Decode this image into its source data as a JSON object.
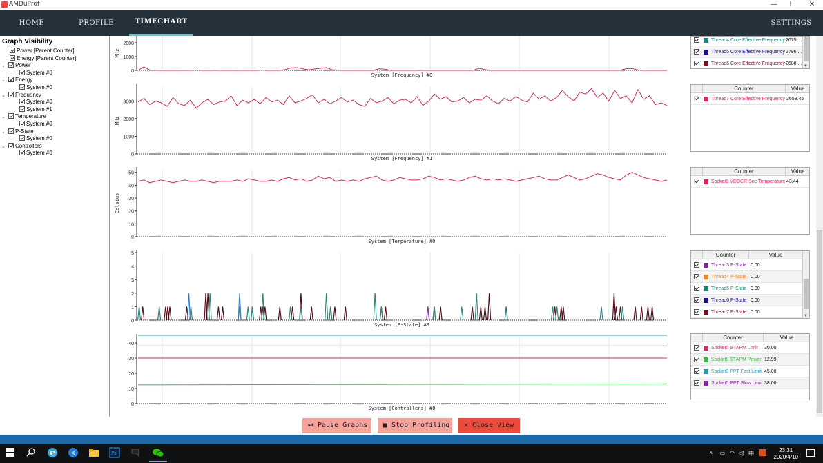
{
  "window": {
    "title": "AMDuProf",
    "min": "—",
    "restore": "❐",
    "close": "✕"
  },
  "nav": {
    "home": "HOME",
    "profile": "PROFILE",
    "timechart": "TIMECHART",
    "settings": "SETTINGS"
  },
  "tree": {
    "title": "Graph Visibility",
    "nodes": [
      {
        "label": "Power [Parent Counter]",
        "depth": 1,
        "arrow": false
      },
      {
        "label": "Energy [Parent Counter]",
        "depth": 1,
        "arrow": false
      },
      {
        "label": "Power",
        "depth": 1,
        "arrow": true
      },
      {
        "label": "System #0",
        "depth": 2,
        "arrow": false
      },
      {
        "label": "Energy",
        "depth": 1,
        "arrow": true
      },
      {
        "label": "System #0",
        "depth": 2,
        "arrow": false
      },
      {
        "label": "Frequency",
        "depth": 1,
        "arrow": true
      },
      {
        "label": "System #0",
        "depth": 2,
        "arrow": false
      },
      {
        "label": "System #1",
        "depth": 2,
        "arrow": false
      },
      {
        "label": "Temperature",
        "depth": 1,
        "arrow": true
      },
      {
        "label": "System #0",
        "depth": 2,
        "arrow": false
      },
      {
        "label": "P-State",
        "depth": 1,
        "arrow": true
      },
      {
        "label": "System #0",
        "depth": 2,
        "arrow": false
      },
      {
        "label": "Controllers",
        "depth": 1,
        "arrow": true
      },
      {
        "label": "System #0",
        "depth": 2,
        "arrow": false
      }
    ]
  },
  "charts": {
    "freq0": {
      "title": "System [Frequency] #0",
      "ylabel": "MHz",
      "ticks": [
        "2000",
        "1000",
        "0"
      ]
    },
    "freq1": {
      "title": "System [Frequency] #1",
      "ylabel": "MHz",
      "ticks": [
        "3000",
        "2000",
        "1000",
        "0"
      ]
    },
    "temp": {
      "title": "System [Temperature] #0",
      "ylabel": "Celsius",
      "ticks": [
        "50",
        "40",
        "30",
        "20",
        "10",
        "0"
      ]
    },
    "pstate": {
      "title": "System [P-State] #0",
      "ylabel": "",
      "ticks": [
        "5",
        "4",
        "3",
        "2",
        "1",
        "0"
      ]
    },
    "ctrl": {
      "title": "System [Controllers] #0",
      "ylabel": "",
      "ticks": [
        "40",
        "30",
        "20",
        "10",
        "0"
      ]
    }
  },
  "chart_data": [
    {
      "type": "line",
      "title": "System [Frequency] #0",
      "ylabel": "MHz",
      "ylim": [
        0,
        2500
      ],
      "series": [
        {
          "color": "#e0245e",
          "values": [
            0,
            250,
            20,
            10,
            0,
            5,
            0,
            0,
            10,
            0,
            30,
            0,
            0,
            10,
            0,
            0,
            0,
            5,
            0,
            0,
            0,
            30,
            0,
            0,
            0,
            50,
            180,
            200,
            120,
            40,
            100,
            150,
            200,
            50,
            20,
            0,
            0,
            0,
            0,
            0,
            0,
            120,
            90,
            0,
            0,
            0,
            0,
            0,
            20,
            0,
            0,
            0,
            0,
            0,
            0,
            0,
            0,
            0,
            150,
            60,
            0,
            0,
            0,
            0,
            0,
            0,
            0,
            0,
            0,
            0,
            0,
            0,
            0,
            0,
            0,
            0,
            0,
            0,
            0,
            0,
            0,
            0,
            0,
            120,
            140,
            40,
            0,
            0,
            0,
            0,
            0
          ]
        }
      ]
    },
    {
      "type": "line",
      "title": "System [Frequency] #1",
      "ylabel": "MHz",
      "ylim": [
        0,
        3800
      ],
      "series": [
        {
          "color": "#e0245e",
          "values": [
            2950,
            3150,
            2800,
            3000,
            2900,
            2700,
            3200,
            2850,
            2750,
            3050,
            2600,
            2900,
            3100,
            2800,
            2950,
            3000,
            3300,
            2750,
            3050,
            2900,
            3100,
            2850,
            3200,
            2950,
            3050,
            2800,
            3300,
            2900,
            3000,
            3150,
            3350,
            2900,
            3100,
            2850,
            3000,
            3200,
            2950,
            3050,
            2800,
            2700,
            3150,
            2900,
            3000,
            3200,
            2850,
            3050,
            3100,
            2900,
            3250,
            2750,
            3000,
            3400,
            3100,
            3250,
            2950,
            3000,
            3200,
            2900,
            3100,
            3050,
            3300,
            3000,
            2850,
            3150,
            3000,
            3250,
            3050,
            2950,
            3450,
            3100,
            3300,
            3000,
            3200,
            3600,
            3250,
            3000,
            3500,
            3400,
            3700,
            3200,
            3450,
            3000,
            3600,
            3150,
            3300,
            2900,
            3650,
            3100,
            3300,
            2800,
            2900,
            2750
          ]
        }
      ]
    },
    {
      "type": "line",
      "title": "System [Temperature] #0",
      "ylabel": "Celsius",
      "ylim": [
        0,
        52
      ],
      "series": [
        {
          "color": "#e0245e",
          "values": [
            43,
            44,
            42,
            43,
            44,
            43,
            42,
            43,
            44,
            43,
            43,
            44,
            43,
            42,
            43,
            43,
            43,
            44,
            43,
            45,
            44,
            43,
            43,
            44,
            43,
            45,
            46,
            44,
            45,
            43,
            44,
            47,
            45,
            46,
            43,
            44,
            43,
            44,
            43,
            45,
            46,
            47,
            44,
            43,
            44,
            46,
            45,
            44,
            44,
            45,
            47,
            46,
            44,
            45,
            44,
            43,
            44,
            46,
            47,
            45,
            44,
            45,
            44,
            45,
            44,
            43,
            44,
            45,
            46,
            47,
            45,
            44,
            44,
            46,
            48,
            46,
            44,
            45,
            47,
            49,
            48,
            46,
            45,
            44,
            48,
            50,
            48,
            46,
            45,
            44,
            43,
            44
          ]
        }
      ]
    },
    {
      "type": "bar",
      "title": "System [P-State] #0",
      "ylim": [
        0,
        5
      ],
      "series": [
        {
          "color": "#5a0d1a",
          "values": [
            [
              2.2,
              1
            ],
            [
              13,
              1
            ],
            [
              14,
              1
            ],
            [
              15,
              1
            ],
            [
              23,
              1
            ],
            [
              32,
              2
            ],
            [
              33,
              2
            ],
            [
              38,
              1
            ],
            [
              40,
              1
            ],
            [
              54,
              1
            ],
            [
              58,
              1
            ],
            [
              59,
              1
            ],
            [
              60,
              1
            ],
            [
              67,
              1
            ],
            [
              73,
              1
            ],
            [
              77,
              2
            ],
            [
              82,
              1
            ],
            [
              91,
              1
            ],
            [
              93,
              1
            ],
            [
              98,
              1
            ],
            [
              115,
              1
            ],
            [
              117,
              1
            ],
            [
              137,
              1
            ],
            [
              140,
              1
            ],
            [
              143,
              1
            ],
            [
              158,
              1
            ],
            [
              162,
              1
            ],
            [
              164,
              1
            ],
            [
              166,
              2
            ],
            [
              174,
              1
            ],
            [
              197,
              1
            ],
            [
              200,
              1
            ],
            [
              201,
              1
            ],
            [
              225,
              2
            ],
            [
              226,
              1
            ],
            [
              228,
              1
            ],
            [
              235,
              1
            ],
            [
              238,
              1
            ],
            [
              241,
              1
            ],
            [
              243,
              1
            ]
          ]
        },
        {
          "color": "#2a8a7a",
          "values": [
            [
              0.5,
              1
            ],
            [
              10,
              1
            ],
            [
              25,
              1
            ],
            [
              34,
              2
            ],
            [
              48,
              1
            ],
            [
              52,
              1
            ],
            [
              54,
              1
            ],
            [
              59,
              2
            ],
            [
              72,
              1
            ],
            [
              77,
              1
            ],
            [
              89,
              2
            ],
            [
              91,
              1
            ],
            [
              112,
              2
            ],
            [
              115,
              1
            ],
            [
              140,
              1
            ],
            [
              153,
              1
            ],
            [
              160,
              2
            ],
            [
              174,
              1
            ],
            [
              196,
              1
            ],
            [
              198,
              1
            ],
            [
              219,
              1
            ],
            [
              229,
              1
            ]
          ]
        },
        {
          "color": "#3a7fc4",
          "values": [
            [
              24,
              2
            ],
            [
              48,
              2
            ]
          ]
        },
        {
          "color": "#7b3fa5",
          "values": [
            [
              137,
              1
            ]
          ]
        }
      ]
    },
    {
      "type": "line",
      "title": "System [Controllers] #0",
      "ylim": [
        0,
        45
      ],
      "series": [
        {
          "color": "#2ab0c8",
          "values": [
            45,
            45
          ]
        },
        {
          "color": "#a03fc8",
          "values": [
            38,
            38
          ]
        },
        {
          "color": "#e0245e",
          "values": [
            30,
            30
          ]
        },
        {
          "color": "#3cb94a",
          "values": [
            12.3,
            13
          ]
        }
      ]
    }
  ],
  "tables": {
    "t1": {
      "rows": [
        {
          "name": "Thread4 Core Effective Frequency",
          "value": "2675....",
          "color": "#0a8f8a"
        },
        {
          "name": "Thread5 Core Effective Frequency",
          "value": "2796....",
          "color": "#141488"
        },
        {
          "name": "Thread6 Core Effective Frequency",
          "value": "2688....",
          "color": "#8a0a1a"
        }
      ]
    },
    "t2": {
      "col1": "Counter",
      "col2": "Value",
      "rows": [
        {
          "name": "Thread7 Core Effective Frequency",
          "value": "2658.45",
          "color": "#e0245e"
        }
      ]
    },
    "t3": {
      "col1": "Counter",
      "col2": "Value",
      "rows": [
        {
          "name": "Socket0 VDDCR Soc Temperature",
          "value": "43.44",
          "color": "#e0245e"
        }
      ]
    },
    "t4": {
      "col1": "Counter",
      "col2": "Value",
      "rows": [
        {
          "name": "Thread3 P-State",
          "value": "0.00",
          "color": "#8b1fa8"
        },
        {
          "name": "Thread4 P-State",
          "value": "0.00",
          "color": "#f08a24"
        },
        {
          "name": "Thread5 P-State",
          "value": "0.00",
          "color": "#0a8f7a"
        },
        {
          "name": "Thread6 P-State",
          "value": "0.00",
          "color": "#141488"
        },
        {
          "name": "Thread7 P-State",
          "value": "0.00",
          "color": "#8a0a1a"
        }
      ]
    },
    "t5": {
      "col1": "Counter",
      "col2": "Value",
      "rows": [
        {
          "name": "Socket0 STAPM Limit",
          "value": "30.00",
          "color": "#e0245e"
        },
        {
          "name": "Socket0 STAPM Power",
          "value": "12.99",
          "color": "#3cb94a"
        },
        {
          "name": "Socket0 PPT Fast Limit",
          "value": "45.00",
          "color": "#1aa0c0"
        },
        {
          "name": "Socket0 PPT Slow Limit",
          "value": "38.00",
          "color": "#8b1fa8"
        }
      ]
    }
  },
  "buttons": {
    "pause": {
      "label": "Pause Graphs",
      "icon": "⏯",
      "color": "#f6a19a"
    },
    "stop": {
      "label": "Stop Profiling",
      "icon": "■",
      "color": "#f6a19a"
    },
    "close": {
      "label": "Close View",
      "icon": "✕",
      "color": "#ec4b3c"
    }
  },
  "taskbar": {
    "time": "23:31",
    "date": "2020/4/10",
    "ime": "中"
  }
}
